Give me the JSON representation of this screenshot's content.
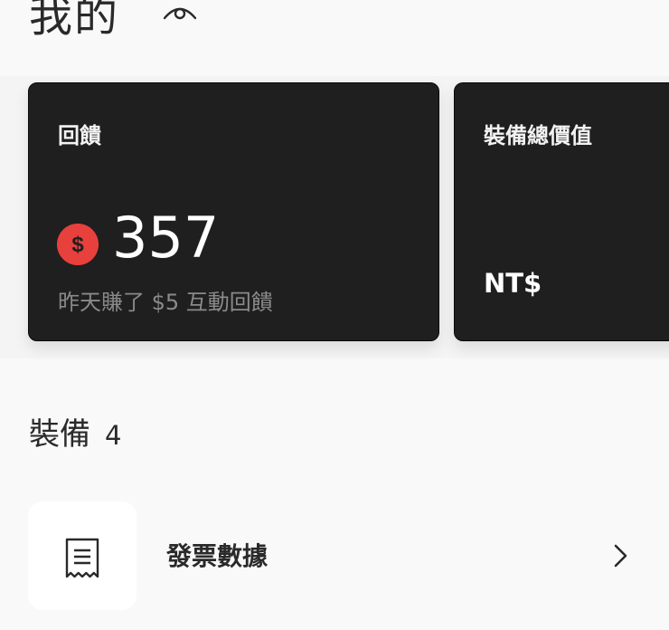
{
  "header": {
    "title": "我的",
    "visibility_icon": "eye-icon"
  },
  "cards": {
    "rewards": {
      "label": "回饋",
      "coin_icon": "dollar-coin-icon",
      "coin_symbol": "$",
      "value": "357",
      "subtitle": "昨天賺了 $5 互動回饋",
      "coin_color": "#e8403d"
    },
    "gear_value": {
      "label": "裝備總價值",
      "value": "NT$"
    }
  },
  "gear_section": {
    "title": "裝備",
    "count": "4"
  },
  "list": {
    "items": [
      {
        "icon": "receipt-icon",
        "label": "發票數據",
        "chevron": "chevron-right-icon"
      }
    ]
  }
}
